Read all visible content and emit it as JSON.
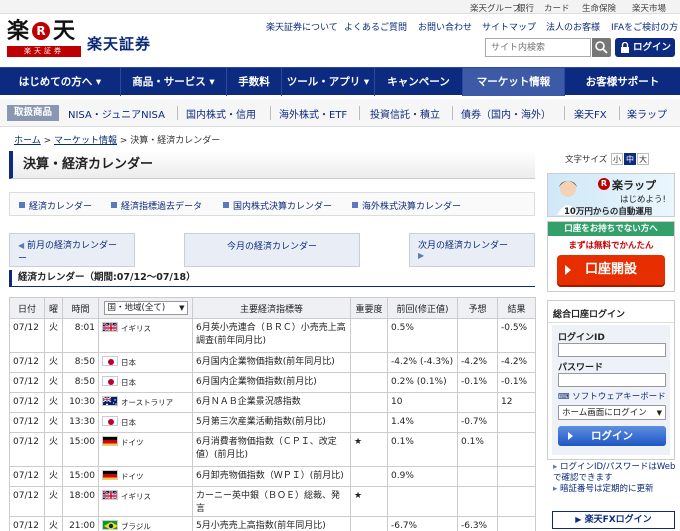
{
  "top_links": [
    "楽天グループ",
    "銀行",
    "カード",
    "生命保険",
    "楽天市場"
  ],
  "brand": {
    "logo_kanji": "楽",
    "logo_r": "R",
    "logo_kanji2": "天",
    "logo_bar": "楽天証券",
    "name": "楽天証券"
  },
  "header_links": [
    "楽天証券について",
    "よくあるご質問",
    "お問い合わせ",
    "サイトマップ",
    "法人のお客様",
    "IFAをご検討の方"
  ],
  "search": {
    "placeholder": "サイト内検索"
  },
  "login_label": "ログイン",
  "main_nav": [
    "はじめての方へ ▾",
    "商品・サービス ▾",
    "手数料",
    "ツール・アプリ ▾",
    "キャンペーン",
    "マーケット情報",
    "お客様サポート"
  ],
  "sub_nav": {
    "label": "取扱商品",
    "items": [
      "NISA・ジュニアNISA",
      "国内株式・信用",
      "海外株式・ETF",
      "投資信託・積立",
      "債券（国内・海外）",
      "楽天FX",
      "楽ラップ"
    ]
  },
  "breadcrumb": {
    "home": "ホーム",
    "sep1": " > ",
    "market": "マーケット情報",
    "sep2": " > ",
    "current": "決算・経済カレンダー"
  },
  "page_title": "決算・経済カレンダー",
  "tabs": [
    "経済カレンダー",
    "経済指標過去データ",
    "国内株式決算カレンダー",
    "海外株式決算カレンダー"
  ],
  "nav_buttons": {
    "prev": "前月の経済カレンダー",
    "dash": "ー",
    "prev_arrow": "◀",
    "current": "今月の経済カレンダー",
    "next": "次月の経済カレンダー",
    "next_arrow": "▶"
  },
  "section_title": "経済カレンダー（期間:07/12～07/18）",
  "table": {
    "headers": [
      "日付",
      "曜",
      "時間",
      "国・地域(全て)",
      "主要経済指標等",
      "重要度",
      "前回(修正値)",
      "予想",
      "結果"
    ],
    "region_select": "国・地域(全て)",
    "rows": [
      {
        "date": "07/12",
        "dow": "火",
        "time": "8:01",
        "country": "イギリス",
        "flag": "uk",
        "indicator": "6月英小売連合（ＢＲＣ）小売売上高調査(前年同月比)",
        "importance": "",
        "prev": "0.5%",
        "forecast": "",
        "result": "-0.5%"
      },
      {
        "date": "07/12",
        "dow": "火",
        "time": "8:50",
        "country": "日本",
        "flag": "jp",
        "indicator": "6月国内企業物価指数(前年同月比)",
        "importance": "",
        "prev": "-4.2% (-4.3%)",
        "forecast": "-4.2%",
        "result": "-4.2%"
      },
      {
        "date": "07/12",
        "dow": "火",
        "time": "8:50",
        "country": "日本",
        "flag": "jp",
        "indicator": "6月国内企業物価指数(前月比)",
        "importance": "",
        "prev": "0.2% (0.1%)",
        "forecast": "-0.1%",
        "result": "-0.1%"
      },
      {
        "date": "07/12",
        "dow": "火",
        "time": "10:30",
        "country": "オーストラリア",
        "flag": "au",
        "indicator": "6月ＮＡＢ企業景況感指数",
        "importance": "",
        "prev": "10",
        "forecast": "",
        "result": "12"
      },
      {
        "date": "07/12",
        "dow": "火",
        "time": "13:30",
        "country": "日本",
        "flag": "jp",
        "indicator": "5月第三次産業活動指数(前月比)",
        "importance": "",
        "prev": "1.4%",
        "forecast": "-0.7%",
        "result": ""
      },
      {
        "date": "07/12",
        "dow": "火",
        "time": "15:00",
        "country": "ドイツ",
        "flag": "de",
        "indicator": "6月消費者物価指数（ＣＰＩ、改定値）(前月比)",
        "importance": "★",
        "prev": "0.1%",
        "forecast": "0.1%",
        "result": ""
      },
      {
        "date": "07/12",
        "dow": "火",
        "time": "15:00",
        "country": "ドイツ",
        "flag": "de",
        "indicator": "6月卸売物価指数（ＷＰＩ）(前月比)",
        "importance": "",
        "prev": "0.9%",
        "forecast": "",
        "result": ""
      },
      {
        "date": "07/12",
        "dow": "火",
        "time": "18:00",
        "country": "イギリス",
        "flag": "uk",
        "indicator": "カーニー英中銀（ＢＯＥ）総裁、発言",
        "importance": "★",
        "prev": "",
        "forecast": "",
        "result": ""
      },
      {
        "date": "07/12",
        "dow": "火",
        "time": "21:00",
        "country": "ブラジル",
        "flag": "br",
        "indicator": "5月小売売上高指数(前年同月比)",
        "importance": "",
        "prev": "-6.7%",
        "forecast": "-6.3%",
        "result": ""
      }
    ]
  },
  "font_size": {
    "label": "文字サイズ",
    "options": [
      "小",
      "中",
      "大"
    ],
    "selected": "中"
  },
  "promo": {
    "logo": "楽ラップ",
    "line1": "はじめよう!",
    "line2": "10万円からの自動運用"
  },
  "open_account": {
    "header": "口座をお持ちでない方へ",
    "sub": "まずは無料でかんたん",
    "button": "口座開設"
  },
  "login_box": {
    "title": "総合口座ログイン",
    "id_label": "ログインID",
    "pw_label": "パスワード",
    "keyboard": "ソフトウェアキーボード",
    "home_select": "ホーム画面にログイン",
    "button": "ログイン"
  },
  "help_links": [
    "ログインID/パスワードはWebで確認できます",
    "暗証番号は定期的に更新"
  ],
  "fx_login": "楽天FXログイン",
  "colors": {
    "navy": "#0c2a80",
    "red": "#bf0000",
    "green": "#33a06a",
    "orange": "#e62e00"
  }
}
